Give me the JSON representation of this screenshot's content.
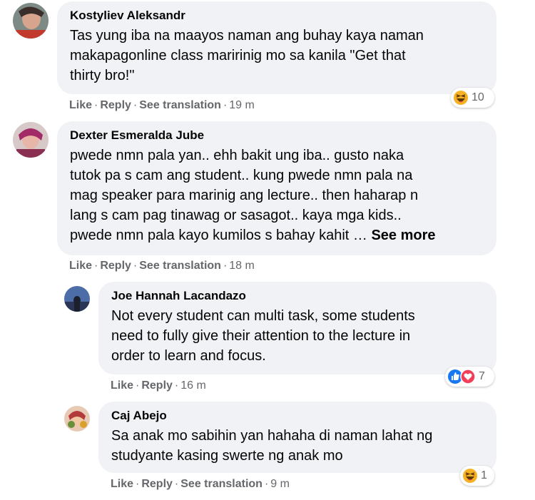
{
  "comments": [
    {
      "author": "Kostyliev Aleksandr",
      "lines": [
        "Tas yung iba na maayos naman ang buhay kaya naman",
        "makapagonline class maririnig mo sa kanila \"Get that",
        "thirty bro!\""
      ],
      "actions": {
        "like": "Like",
        "reply": "Reply",
        "translate": "See translation",
        "time": "19 m"
      },
      "reaction": {
        "icon": "haha-icon",
        "count": "10"
      }
    },
    {
      "author": "Dexter Esmeralda Jube",
      "lines": [
        "pwede nmn pala yan.. ehh bakit ung iba.. gusto naka",
        "tutok pa s cam ang student.. kung pwede nmn pala na",
        "mag speaker para marinig ang lecture.. then haharap n",
        "lang s cam pag tinawag or sasagot.. kaya mga kids..",
        "pwede nmn pala kayo kumilos s bahay kahit … "
      ],
      "see_more": "See more",
      "actions": {
        "like": "Like",
        "reply": "Reply",
        "translate": "See translation",
        "time": "18 m"
      }
    }
  ],
  "replies": [
    {
      "author": "Joe Hannah Lacandazo",
      "lines": [
        "Not every student can multi task, some students",
        "need to fully give their attention to the lecture in",
        "order to learn and focus."
      ],
      "actions": {
        "like": "Like",
        "reply": "Reply",
        "time": "16 m"
      },
      "reaction": {
        "icons": [
          "like-icon",
          "love-icon"
        ],
        "count": "7"
      }
    },
    {
      "author": "Caj Abejo",
      "lines": [
        "Sa anak mo sabihin yan hahaha di naman lahat ng",
        "studyante kasing swerte ng anak mo"
      ],
      "actions": {
        "like": "Like",
        "reply": "Reply",
        "translate": "See translation",
        "time": "9 m"
      },
      "reaction": {
        "icon": "haha-icon",
        "count": "1"
      }
    }
  ],
  "separator": "·",
  "colors": {
    "bubble": "#f0f2f5",
    "meta": "#65676b",
    "like": "#1877f2",
    "love": "#f33e58",
    "haha": "#f7b125"
  }
}
